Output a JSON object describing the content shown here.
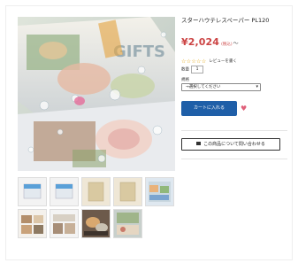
{
  "product": {
    "title": "スターハウテレスペーパー PL120",
    "price": "¥2,024",
    "tax_label": "(税込)",
    "price_tilde": "〜",
    "stars": "☆☆☆☆☆",
    "review_link": "レビューを書く",
    "quantity_label": "数量",
    "quantity_value": "1",
    "spec_label": "規格",
    "spec_select_value": "→選択してください",
    "add_to_cart": "カートに入れる",
    "contact_button": "この商品について問い合わせる"
  },
  "main_image": {
    "text_overlay": "GIFTS"
  },
  "colors": {
    "price": "#cc4444",
    "cart_button": "#1f5fa8",
    "favorite_heart": "#e0607a"
  },
  "icons": [
    "heart-icon",
    "mail-icon",
    "dropdown-caret-icon",
    "star-icon"
  ]
}
